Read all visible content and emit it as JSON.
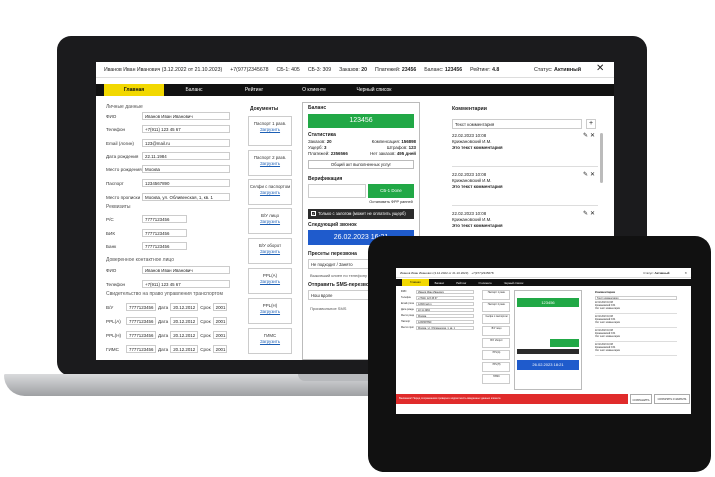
{
  "laptop": {
    "header": {
      "name": "Иванов Иван Иванович (3.12.2022 от 21.10.2023)",
      "phone": "+7(977)2345678",
      "cb1": "СБ-1: 405",
      "cb3": "СБ-3: 309",
      "orders_label": "Заказов:",
      "orders": "20",
      "payments_label": "Платежей:",
      "payments": "23456",
      "balance_label": "Баланс:",
      "balance": "123456",
      "rating_label": "Рейтинг:",
      "rating": "4.8",
      "status_label": "Статус:",
      "status": "Активный"
    },
    "tabs": [
      "Главная",
      "Баланс",
      "Рейтинг",
      "О клиенте",
      "Черный список"
    ],
    "personal": {
      "section_title": "Личные данные",
      "rows": [
        {
          "label": "ФИО",
          "value": "Иванов Иван Иванович"
        },
        {
          "label": "Телефон",
          "value": "+7(911) 123 45 67"
        },
        {
          "label": "Email (логин)",
          "value": "123@mail.ru"
        },
        {
          "label": "Дата рождения",
          "value": "22.11.1984"
        },
        {
          "label": "Место рождения",
          "value": "Москва"
        },
        {
          "label": "Паспорт",
          "value": "1234567890"
        },
        {
          "label": "Место прописки",
          "value": "Москва, ул. Обливенская, 1, кв. 1"
        }
      ]
    },
    "details": {
      "section_title": "Реквизиты",
      "rows": [
        {
          "label": "Р/С",
          "value": "7777123456"
        },
        {
          "label": "БИК",
          "value": "7777123456"
        },
        {
          "label": "Банк",
          "value": "7777123456"
        }
      ]
    },
    "contact": {
      "section_title": "Доверенное контактное лицо",
      "rows": [
        {
          "label": "ФИО",
          "value": "Иванов Иван Иванович"
        },
        {
          "label": "Телефон",
          "value": "+7(911) 123 45 67"
        }
      ]
    },
    "certificates": {
      "section_title": "Свидетельство на право управления транспортом",
      "rows": [
        {
          "label": "В/У",
          "num": "7777123456",
          "date_l": "Дата",
          "date": "20.12.2012",
          "exp_l": "Срок",
          "exp": "2001"
        },
        {
          "label": "PPL(A)",
          "num": "7777123456",
          "date_l": "Дата",
          "date": "20.12.2012",
          "exp_l": "Срок",
          "exp": "2001"
        },
        {
          "label": "PPL(H)",
          "num": "7777123456",
          "date_l": "Дата",
          "date": "20.12.2012",
          "exp_l": "Срок",
          "exp": "2001"
        },
        {
          "label": "ГИМС",
          "num": "7777123456",
          "date_l": "Дата",
          "date": "20.12.2012",
          "exp_l": "Срок",
          "exp": "2001"
        }
      ]
    },
    "documents": {
      "title": "Документы",
      "upload": "Загрузить",
      "items": [
        "Паспорт 1 разв.",
        "Паспорт 2 разв.",
        "Селфи с паспортом",
        "В/У лицо",
        "В/У оборот",
        "PPL(A)",
        "PPL(H)",
        "ГИМС"
      ]
    },
    "balance": {
      "title": "Баланс",
      "value": "123456",
      "stats_title": "Статистика",
      "orders_label": "Заказов:",
      "orders": "20",
      "damage_label": "Ущерб:",
      "damage": "3",
      "payments_label": "Платежей:",
      "payments": "2356566",
      "compensation_label": "Компенсация:",
      "compensation": "156898",
      "fines_label": "Штрафов:",
      "fines": "123",
      "unpaid_label": "Нет заказов:",
      "unpaid": "495 дней",
      "services_button": "Общий акт выполненных услуг",
      "verification_title": "Верификация",
      "verify_button": "СБ-1 Done",
      "stop_button": "Остановить ФРР ранней",
      "checkbox_label": "Только с залогом (может не оплатить ущерб)",
      "next_call_title": "Следующий звонок",
      "next_call_value": "26.02.2023 16:21",
      "presets_title": "Пресеты перезвона",
      "preset_select": "Не подходит / Занято",
      "preset_text": "Выживший клиен по телефону",
      "sms_title": "Отправить SMS-перезвон",
      "sms_select": "Нош вдоле",
      "sms_hint": "Произвольное SMS"
    },
    "comments": {
      "title": "Комментарии",
      "placeholder": "Текст комментария",
      "add": "+",
      "items": [
        {
          "date": "22.02.2023 10:08",
          "author": "Крижановский И.М.",
          "text": "Это текст комментария"
        },
        {
          "date": "22.02.2023 10:08",
          "author": "Крижановский И.М.",
          "text": "Это текст комментария"
        },
        {
          "date": "22.02.2023 10:08",
          "author": "Крижановский И.М.",
          "text": "Это текст комментария"
        },
        {
          "date": "22.02.2023 10:08",
          "author": "Крижановский И.М.",
          "text": "Это текст комментария"
        }
      ]
    }
  },
  "tablet": {
    "tabs": [
      "Главная",
      "Баланс",
      "Рейтинг",
      "О клиенте",
      "Черный список"
    ],
    "balance_value": "123456",
    "next_call_value": "26.02.2023 18:21",
    "comments_title": "Комментарии",
    "comment_placeholder": "Текст комментария",
    "status": "Активный",
    "save_button": "СОХРАНИТЬ",
    "save_close_button": "СОХРАНИТЬ И ЗАКРЫТЬ",
    "warning": "Внимание! Перед сохранением проверьте корректность введенных данных клиента"
  }
}
